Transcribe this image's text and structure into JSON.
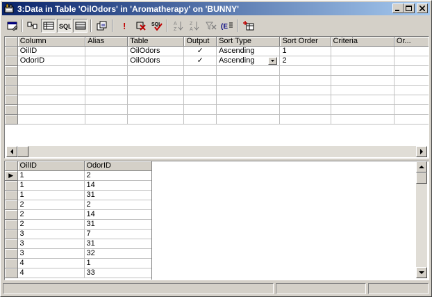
{
  "window": {
    "title": "3:Data in Table 'OilOdors' in 'Aromatherapy' on 'BUNNY'"
  },
  "toolbar": {
    "buttons": [
      {
        "icon": "properties-icon"
      },
      {
        "icon": "diagram-pane-icon"
      },
      {
        "icon": "grid-pane-icon"
      },
      {
        "icon": "sql-pane-icon",
        "label": "SQL"
      },
      {
        "icon": "results-pane-icon"
      },
      {
        "icon": "change-query-type-icon"
      },
      {
        "icon": "run-icon",
        "label": "!"
      },
      {
        "icon": "stop-query-icon"
      },
      {
        "icon": "verify-sql-icon",
        "label": "SQL"
      },
      {
        "icon": "sort-ascending-icon",
        "label_top": "A",
        "label_bottom": "Z"
      },
      {
        "icon": "sort-descending-icon",
        "label_top": "Z",
        "label_bottom": "A"
      },
      {
        "icon": "remove-filter-icon"
      },
      {
        "icon": "group-by-icon",
        "label": "(E"
      },
      {
        "icon": "add-table-icon"
      }
    ]
  },
  "criteria_grid": {
    "headers": [
      "Column",
      "Alias",
      "Table",
      "Output",
      "Sort Type",
      "Sort Order",
      "Criteria",
      "Or..."
    ],
    "rows": [
      {
        "column": "OilID",
        "alias": "",
        "table": "OilOdors",
        "output": "✓",
        "sort_type": "Ascending",
        "sort_order": "1",
        "criteria": "",
        "or": ""
      },
      {
        "column": "OdorID",
        "alias": "",
        "table": "OilOdors",
        "output": "✓",
        "sort_type": "Ascending",
        "sort_order": "2",
        "criteria": "",
        "or": ""
      }
    ],
    "empty_rows": 6
  },
  "results_grid": {
    "headers": [
      "OilID",
      "OdorID"
    ],
    "current_row_marker": "▶",
    "rows": [
      [
        "1",
        "2"
      ],
      [
        "1",
        "14"
      ],
      [
        "1",
        "31"
      ],
      [
        "2",
        "2"
      ],
      [
        "2",
        "14"
      ],
      [
        "2",
        "31"
      ],
      [
        "3",
        "7"
      ],
      [
        "3",
        "31"
      ],
      [
        "3",
        "32"
      ],
      [
        "4",
        "1"
      ],
      [
        "4",
        "33"
      ]
    ]
  },
  "title_buttons": {
    "minimize": "_",
    "maximize": "□",
    "close": "✕"
  }
}
